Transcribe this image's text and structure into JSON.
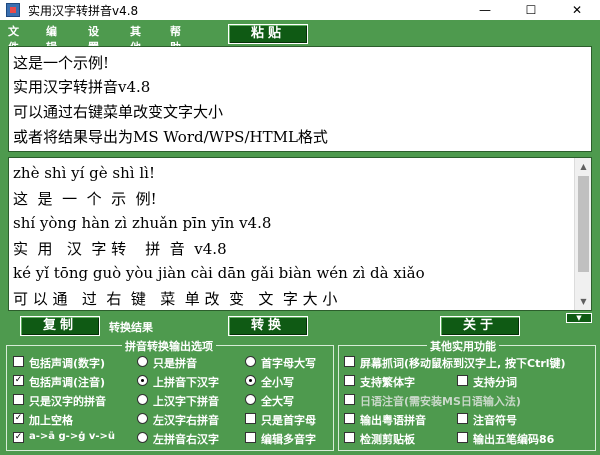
{
  "window": {
    "title": "实用汉字转拼音v4.8",
    "minimize": "—",
    "maximize": "☐",
    "close": "✕"
  },
  "menu": [
    "文件",
    "编辑",
    "设置",
    "其他",
    "帮助"
  ],
  "buttons": {
    "paste": "粘贴",
    "copy": "复制",
    "convert": "转换",
    "about": "关于"
  },
  "input_lines": [
    "这是一个示例!",
    "实用汉字转拼音v4.8",
    "可以通过右键菜单改变文字大小",
    "或者将结果导出为MS Word/WPS/HTML格式"
  ],
  "output_lines": [
    "zhè shì yí gè shì lì!",
    "这  是  一  个  示  例!",
    "shí yòng hàn zì zhuǎn pīn yīn v4.8",
    "实  用   汉  字 转    拼  音  v4.8",
    "ké yǐ tōng guò yòu jiàn cài dān gǎi biàn wén zì dà xiǎo",
    "可 以 通   过  右  键   菜  单 改  变   文  字 大 小"
  ],
  "result_label": "转换结果",
  "groups": {
    "pinyin_title": "拼音转换输出选项",
    "other_title": "其他实用功能"
  },
  "pinyin_options": {
    "col1": [
      {
        "label": "包括声调(数字)",
        "checked": false
      },
      {
        "label": "包括声调(注音)",
        "checked": true
      },
      {
        "label": "只是汉字的拼音",
        "checked": false
      },
      {
        "label": "加上空格",
        "checked": true
      },
      {
        "label": "a->ā g->ġ v->ü",
        "checked": true
      }
    ],
    "col2": [
      {
        "label": "只是拼音",
        "selected": false
      },
      {
        "label": "上拼音下汉字",
        "selected": true
      },
      {
        "label": "上汉字下拼音",
        "selected": false
      },
      {
        "label": "左汉字右拼音",
        "selected": false
      },
      {
        "label": "左拼音右汉字",
        "selected": false
      }
    ],
    "col3": [
      {
        "label": "首字母大写",
        "type": "radio",
        "selected": false
      },
      {
        "label": "全小写",
        "type": "radio",
        "selected": true
      },
      {
        "label": "全大写",
        "type": "radio",
        "selected": false
      },
      {
        "label": "只是首字母",
        "type": "checkbox",
        "checked": false
      },
      {
        "label": "编辑多音字",
        "type": "checkbox",
        "checked": false
      }
    ]
  },
  "other_options": {
    "rows": [
      [
        {
          "label": "屏幕抓词(移动鼠标到汉字上, 按下Ctrl键)",
          "checked": false,
          "enabled": true
        }
      ],
      [
        {
          "label": "支持繁体字",
          "checked": false,
          "enabled": true
        },
        {
          "label": "支持分词",
          "checked": false,
          "enabled": true
        }
      ],
      [
        {
          "label": "日语注音(需安装MS日语输入法)",
          "checked": false,
          "enabled": false
        }
      ],
      [
        {
          "label": "输出粤语拼音",
          "checked": false,
          "enabled": true
        },
        {
          "label": "注音符号",
          "checked": false,
          "enabled": true
        }
      ],
      [
        {
          "label": "检测剪贴板",
          "checked": false,
          "enabled": true
        },
        {
          "label": "输出五笔编码86",
          "checked": false,
          "enabled": true
        }
      ]
    ]
  },
  "colors": {
    "frame": "#4e9a4e",
    "button": "#0f5a14"
  }
}
